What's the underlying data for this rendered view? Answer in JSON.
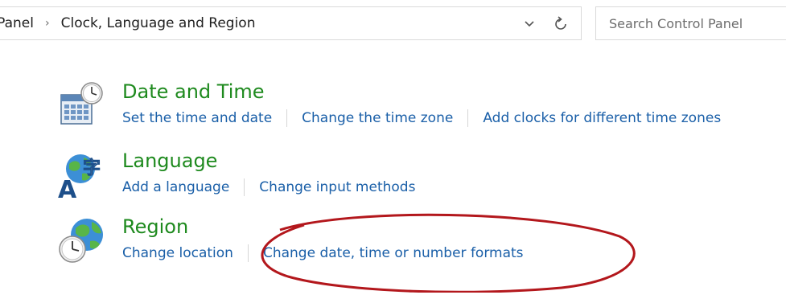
{
  "address_bar": {
    "breadcrumb_root": "l Panel",
    "separator": "›",
    "breadcrumb_current": "Clock, Language and Region",
    "dropdown_icon": "chevron-down-icon",
    "refresh_icon": "refresh-icon"
  },
  "search": {
    "placeholder": "Search Control Panel"
  },
  "categories": [
    {
      "title": "Date and Time",
      "icon": "calendar-clock-icon",
      "links": [
        "Set the time and date",
        "Change the time zone",
        "Add clocks for different time zones"
      ]
    },
    {
      "title": "Language",
      "icon": "language-icon",
      "links": [
        "Add a language",
        "Change input methods"
      ]
    },
    {
      "title": "Region",
      "icon": "globe-clock-icon",
      "links": [
        "Change location",
        "Change date, time or number formats"
      ]
    }
  ],
  "colors": {
    "category_title": "#1e8a1e",
    "link": "#1a5fa8",
    "annotation": "#b3171c",
    "border": "#d9d9d9"
  }
}
